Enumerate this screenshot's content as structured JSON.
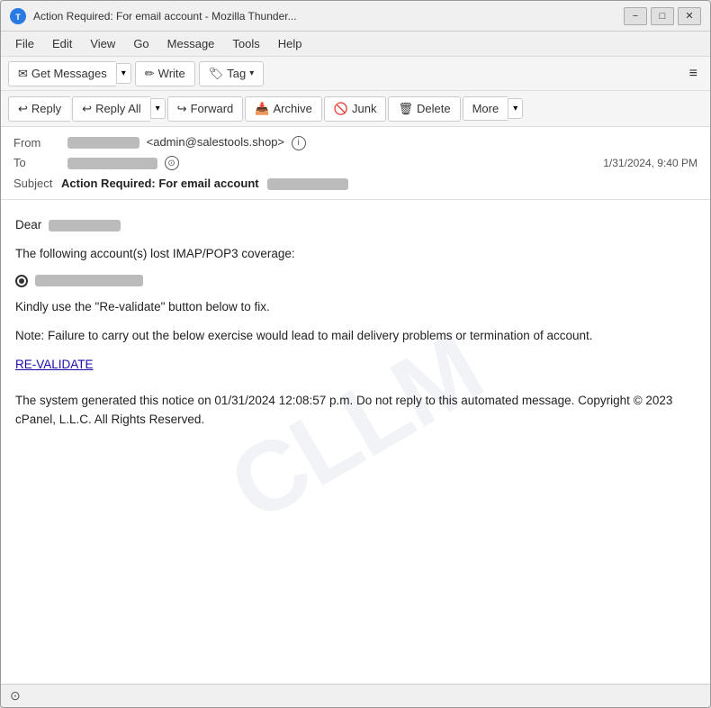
{
  "titlebar": {
    "title": "Action Required: For email account          - Mozilla Thunder...",
    "icon": "TB",
    "minimize_label": "−",
    "maximize_label": "□",
    "close_label": "✕"
  },
  "menubar": {
    "items": [
      "File",
      "Edit",
      "View",
      "Go",
      "Message",
      "Tools",
      "Help"
    ]
  },
  "toolbar": {
    "get_messages_label": "Get Messages",
    "write_label": "Write",
    "tag_label": "Tag",
    "hamburger": "≡"
  },
  "action_toolbar": {
    "reply_label": "Reply",
    "reply_all_label": "Reply All",
    "forward_label": "Forward",
    "archive_label": "Archive",
    "junk_label": "Junk",
    "delete_label": "Delete",
    "more_label": "More"
  },
  "email_header": {
    "from_label": "From",
    "from_name": "██████████",
    "from_email": "<admin@salestools.shop>",
    "to_label": "To",
    "to_value": "██████████",
    "date": "1/31/2024, 9:40 PM",
    "subject_label": "Subject",
    "subject_bold": "Action Required: For email account",
    "subject_redacted": "████████████"
  },
  "email_body": {
    "greeting": "Dear",
    "greeting_name": "██████████",
    "para1": "The following account(s) lost IMAP/POP3 coverage:",
    "account_redacted": "████████████████",
    "para2": "Kindly use the \"Re-validate\" button below to fix.",
    "para3": "Note: Failure to carry out the below exercise would lead to mail delivery problems or termination of account.",
    "revalidate_link": "RE-VALIDATE",
    "para4": "The system generated this notice on 01/31/2024 12:08:57 p.m. Do not reply to this automated message. Copyright © 2023 cPanel, L.L.C. All Rights Reserved.",
    "watermark": "CLLM"
  },
  "statusbar": {
    "icon": "⊙"
  }
}
